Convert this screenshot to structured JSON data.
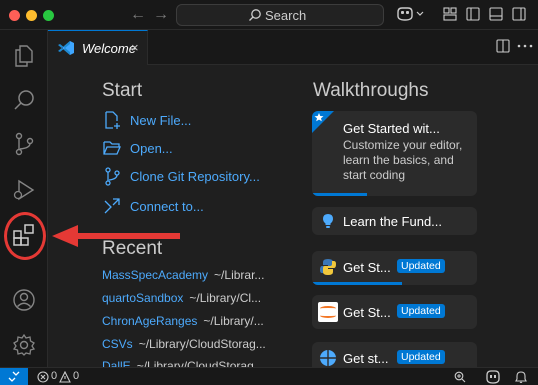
{
  "titlebar": {
    "search_label": "Search",
    "traffic_colors": [
      "#ff5f57",
      "#febc2e",
      "#28c840"
    ]
  },
  "activity_bar": {
    "items": [
      "explorer-icon",
      "search-icon",
      "source-control-icon",
      "run-debug-icon",
      "extensions-icon"
    ],
    "bottom_items": [
      "accounts-icon",
      "manage-gear-icon"
    ]
  },
  "tabs": [
    {
      "label": "Welcome",
      "close": "×"
    }
  ],
  "welcome": {
    "start_heading": "Start",
    "start_items": [
      {
        "label": "New File...",
        "icon": "new-file-icon"
      },
      {
        "label": "Open...",
        "icon": "folder-open-icon"
      },
      {
        "label": "Clone Git Repository...",
        "icon": "git-clone-icon"
      },
      {
        "label": "Connect to...",
        "icon": "remote-connect-icon"
      }
    ],
    "recent_heading": "Recent",
    "recent_items": [
      {
        "name": "MassSpecAcademy",
        "path": "~/Librar..."
      },
      {
        "name": "quartoSandbox",
        "path": "~/Library/Cl..."
      },
      {
        "name": "ChronAgeRanges",
        "path": "~/Library/..."
      },
      {
        "name": "CSVs",
        "path": "~/Library/CloudStorag..."
      },
      {
        "name": "DallE",
        "path": "~/Library/CloudStorag..."
      }
    ],
    "walkthroughs_heading": "Walkthroughs",
    "walkthroughs": [
      {
        "title": "Get Started wit...",
        "description": "Customize your editor, learn the basics, and start coding",
        "progress": 0.33,
        "icon": "star-icon"
      },
      {
        "title": "Learn the Fund...",
        "icon": "lightbulb-icon"
      },
      {
        "title": "Get St...",
        "badge": "Updated",
        "progress": 0.55,
        "icon": "python-icon"
      },
      {
        "title": "Get St...",
        "badge": "Updated",
        "icon": "jupyter-icon"
      },
      {
        "title": "Get st...",
        "badge": "Updated",
        "icon": "globe-icon"
      }
    ]
  },
  "status_bar": {
    "errors": "0",
    "warnings": "0"
  },
  "colors": {
    "accent": "#0078d4",
    "link": "#4daafc",
    "annotation": "#e53935"
  }
}
